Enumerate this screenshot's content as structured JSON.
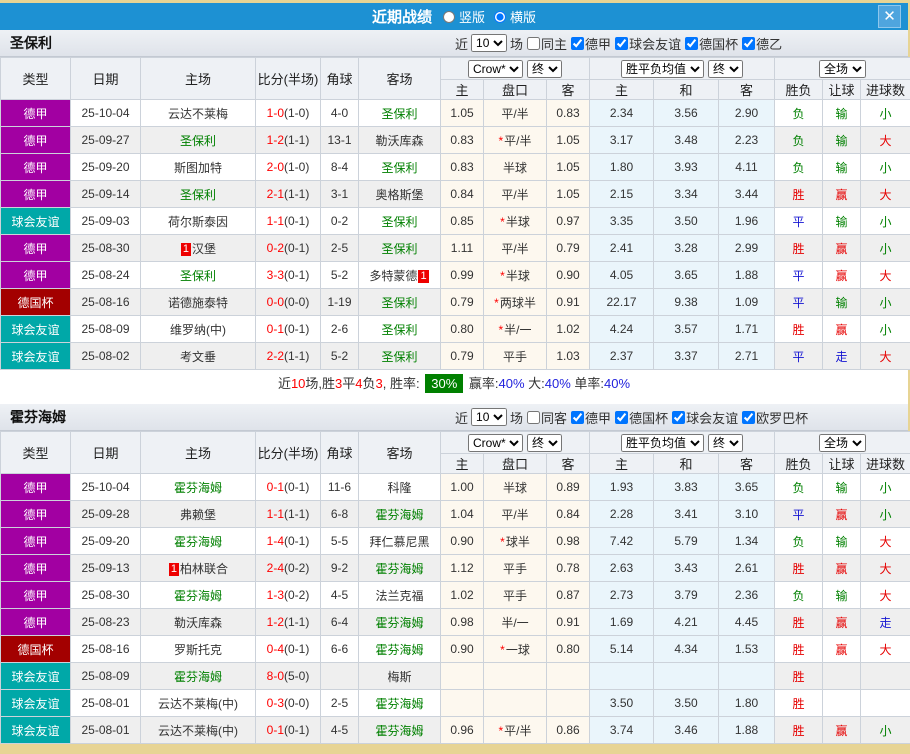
{
  "titlebar": {
    "title": "近期战绩",
    "layout_options": [
      {
        "label": "竖版",
        "selected": false
      },
      {
        "label": "横版",
        "selected": true
      }
    ],
    "close_label": "✕"
  },
  "filter_labels": {
    "near": "近",
    "games": "场"
  },
  "table_header": {
    "left_cols": [
      "类型",
      "日期",
      "主场",
      "比分(半场)",
      "角球",
      "客场"
    ],
    "odds_groups": [
      {
        "selects": [
          "Crow*",
          "终"
        ]
      },
      {
        "selects": [
          "胜平负均值",
          "终"
        ]
      },
      {
        "selects": [
          "全场"
        ]
      }
    ],
    "sub_cols": [
      "主",
      "盘口",
      "客",
      "主",
      "和",
      "客",
      "胜负",
      "让球",
      "进球数"
    ]
  },
  "colors": {
    "header_blue": "#1d91d3",
    "type": {
      "德甲": "#a200a2",
      "球会友谊": "#00a8a8",
      "德国杯": "#a30000"
    },
    "team_green": "#008000",
    "score_red": "#ff0000",
    "result": {
      "胜": "#e60000",
      "平": "#1414d2",
      "负": "#008000"
    },
    "handicap_result": {
      "赢": "#e60000",
      "输": "#008000",
      "走": "#1414d2"
    },
    "goals": {
      "大": "#e60000",
      "小": "#008000",
      "走": "#1414d2"
    }
  },
  "sections": [
    {
      "team": "圣保利",
      "filter": {
        "count": "10",
        "same_venue": {
          "label": "同主",
          "checked": false
        },
        "leagues": [
          {
            "label": "德甲",
            "checked": true
          },
          {
            "label": "球会友谊",
            "checked": true
          },
          {
            "label": "德国杯",
            "checked": true
          },
          {
            "label": "德乙",
            "checked": true
          }
        ]
      },
      "rows": [
        {
          "type": "德甲",
          "date": "25-10-04",
          "home": "云达不莱梅",
          "home_is_team": false,
          "home_badge": "",
          "home_badge_pos": "",
          "score": "1-0",
          "half": "(1-0)",
          "corner": "4-0",
          "away": "圣保利",
          "away_is_team": true,
          "away_badge": "",
          "away_badge_pos": "",
          "crow_home": "1.05",
          "handicap": "平/半",
          "handicap_star": false,
          "crow_away": "0.83",
          "avg_home": "2.34",
          "avg_draw": "3.56",
          "avg_away": "2.90",
          "result": "负",
          "handicap_result": "输",
          "goals_result": "小"
        },
        {
          "type": "德甲",
          "date": "25-09-27",
          "home": "圣保利",
          "home_is_team": true,
          "home_badge": "",
          "home_badge_pos": "",
          "score": "1-2",
          "half": "(1-1)",
          "corner": "13-1",
          "away": "勒沃库森",
          "away_is_team": false,
          "away_badge": "",
          "away_badge_pos": "",
          "crow_home": "0.83",
          "handicap": "平/半",
          "handicap_star": true,
          "crow_away": "1.05",
          "avg_home": "3.17",
          "avg_draw": "3.48",
          "avg_away": "2.23",
          "result": "负",
          "handicap_result": "输",
          "goals_result": "大"
        },
        {
          "type": "德甲",
          "date": "25-09-20",
          "home": "斯图加特",
          "home_is_team": false,
          "home_badge": "",
          "home_badge_pos": "",
          "score": "2-0",
          "half": "(1-0)",
          "corner": "8-4",
          "away": "圣保利",
          "away_is_team": true,
          "away_badge": "",
          "away_badge_pos": "",
          "crow_home": "0.83",
          "handicap": "半球",
          "handicap_star": false,
          "crow_away": "1.05",
          "avg_home": "1.80",
          "avg_draw": "3.93",
          "avg_away": "4.11",
          "result": "负",
          "handicap_result": "输",
          "goals_result": "小"
        },
        {
          "type": "德甲",
          "date": "25-09-14",
          "home": "圣保利",
          "home_is_team": true,
          "home_badge": "",
          "home_badge_pos": "",
          "score": "2-1",
          "half": "(1-1)",
          "corner": "3-1",
          "away": "奥格斯堡",
          "away_is_team": false,
          "away_badge": "",
          "away_badge_pos": "",
          "crow_home": "0.84",
          "handicap": "平/半",
          "handicap_star": false,
          "crow_away": "1.05",
          "avg_home": "2.15",
          "avg_draw": "3.34",
          "avg_away": "3.44",
          "result": "胜",
          "handicap_result": "赢",
          "goals_result": "大"
        },
        {
          "type": "球会友谊",
          "date": "25-09-03",
          "home": "荷尔斯泰因",
          "home_is_team": false,
          "home_badge": "",
          "home_badge_pos": "",
          "score": "1-1",
          "half": "(0-1)",
          "corner": "0-2",
          "away": "圣保利",
          "away_is_team": true,
          "away_badge": "",
          "away_badge_pos": "",
          "crow_home": "0.85",
          "handicap": "半球",
          "handicap_star": true,
          "crow_away": "0.97",
          "avg_home": "3.35",
          "avg_draw": "3.50",
          "avg_away": "1.96",
          "result": "平",
          "handicap_result": "输",
          "goals_result": "小"
        },
        {
          "type": "德甲",
          "date": "25-08-30",
          "home": "汉堡",
          "home_is_team": false,
          "home_badge": "1",
          "home_badge_pos": "before",
          "score": "0-2",
          "half": "(0-1)",
          "corner": "2-5",
          "away": "圣保利",
          "away_is_team": true,
          "away_badge": "",
          "away_badge_pos": "",
          "crow_home": "1.11",
          "handicap": "平/半",
          "handicap_star": false,
          "crow_away": "0.79",
          "avg_home": "2.41",
          "avg_draw": "3.28",
          "avg_away": "2.99",
          "result": "胜",
          "handicap_result": "赢",
          "goals_result": "小"
        },
        {
          "type": "德甲",
          "date": "25-08-24",
          "home": "圣保利",
          "home_is_team": true,
          "home_badge": "",
          "home_badge_pos": "",
          "score": "3-3",
          "half": "(0-1)",
          "corner": "5-2",
          "away": "多特蒙德",
          "away_is_team": false,
          "away_badge": "1",
          "away_badge_pos": "after",
          "crow_home": "0.99",
          "handicap": "半球",
          "handicap_star": true,
          "crow_away": "0.90",
          "avg_home": "4.05",
          "avg_draw": "3.65",
          "avg_away": "1.88",
          "result": "平",
          "handicap_result": "赢",
          "goals_result": "大"
        },
        {
          "type": "德国杯",
          "date": "25-08-16",
          "home": "诺德施泰特",
          "home_is_team": false,
          "home_badge": "",
          "home_badge_pos": "",
          "score": "0-0",
          "half": "(0-0)",
          "corner": "1-19",
          "away": "圣保利",
          "away_is_team": true,
          "away_badge": "",
          "away_badge_pos": "",
          "crow_home": "0.79",
          "handicap": "两球半",
          "handicap_star": true,
          "crow_away": "0.91",
          "avg_home": "22.17",
          "avg_draw": "9.38",
          "avg_away": "1.09",
          "result": "平",
          "handicap_result": "输",
          "goals_result": "小"
        },
        {
          "type": "球会友谊",
          "date": "25-08-09",
          "home": "维罗纳(中)",
          "home_is_team": false,
          "home_badge": "",
          "home_badge_pos": "",
          "score": "0-1",
          "half": "(0-1)",
          "corner": "2-6",
          "away": "圣保利",
          "away_is_team": true,
          "away_badge": "",
          "away_badge_pos": "",
          "crow_home": "0.80",
          "handicap": "半/一",
          "handicap_star": true,
          "crow_away": "1.02",
          "avg_home": "4.24",
          "avg_draw": "3.57",
          "avg_away": "1.71",
          "result": "胜",
          "handicap_result": "赢",
          "goals_result": "小"
        },
        {
          "type": "球会友谊",
          "date": "25-08-02",
          "home": "考文垂",
          "home_is_team": false,
          "home_badge": "",
          "home_badge_pos": "",
          "score": "2-2",
          "half": "(1-1)",
          "corner": "5-2",
          "away": "圣保利",
          "away_is_team": true,
          "away_badge": "",
          "away_badge_pos": "",
          "crow_home": "0.79",
          "handicap": "平手",
          "handicap_star": false,
          "crow_away": "1.03",
          "avg_home": "2.37",
          "avg_draw": "3.37",
          "avg_away": "2.71",
          "result": "平",
          "handicap_result": "走",
          "goals_result": "大"
        }
      ],
      "summary_parts": [
        {
          "t": "近"
        },
        {
          "t": "10",
          "c": "red"
        },
        {
          "t": "场,胜"
        },
        {
          "t": "3",
          "c": "red"
        },
        {
          "t": "平"
        },
        {
          "t": "4",
          "c": "red"
        },
        {
          "t": "负"
        },
        {
          "t": "3",
          "c": "red"
        },
        {
          "t": ", 胜率: "
        },
        {
          "t": "30%",
          "c": "greenbox"
        },
        {
          "t": " 赢率:"
        },
        {
          "t": "40%",
          "c": "blue"
        },
        {
          "t": " 大:"
        },
        {
          "t": "40%",
          "c": "blue"
        },
        {
          "t": " 单率:"
        },
        {
          "t": "40%",
          "c": "blue"
        }
      ]
    },
    {
      "team": "霍芬海姆",
      "filter": {
        "count": "10",
        "same_venue": {
          "label": "同客",
          "checked": false
        },
        "leagues": [
          {
            "label": "德甲",
            "checked": true
          },
          {
            "label": "德国杯",
            "checked": true
          },
          {
            "label": "球会友谊",
            "checked": true
          },
          {
            "label": "欧罗巴杯",
            "checked": true
          }
        ]
      },
      "rows": [
        {
          "type": "德甲",
          "date": "25-10-04",
          "home": "霍芬海姆",
          "home_is_team": true,
          "home_badge": "",
          "home_badge_pos": "",
          "score": "0-1",
          "half": "(0-1)",
          "corner": "11-6",
          "away": "科隆",
          "away_is_team": false,
          "away_badge": "",
          "away_badge_pos": "",
          "crow_home": "1.00",
          "handicap": "半球",
          "handicap_star": false,
          "crow_away": "0.89",
          "avg_home": "1.93",
          "avg_draw": "3.83",
          "avg_away": "3.65",
          "result": "负",
          "handicap_result": "输",
          "goals_result": "小"
        },
        {
          "type": "德甲",
          "date": "25-09-28",
          "home": "弗赖堡",
          "home_is_team": false,
          "home_badge": "",
          "home_badge_pos": "",
          "score": "1-1",
          "half": "(1-1)",
          "corner": "6-8",
          "away": "霍芬海姆",
          "away_is_team": true,
          "away_badge": "",
          "away_badge_pos": "",
          "crow_home": "1.04",
          "handicap": "平/半",
          "handicap_star": false,
          "crow_away": "0.84",
          "avg_home": "2.28",
          "avg_draw": "3.41",
          "avg_away": "3.10",
          "result": "平",
          "handicap_result": "赢",
          "goals_result": "小"
        },
        {
          "type": "德甲",
          "date": "25-09-20",
          "home": "霍芬海姆",
          "home_is_team": true,
          "home_badge": "",
          "home_badge_pos": "",
          "score": "1-4",
          "half": "(0-1)",
          "corner": "5-5",
          "away": "拜仁慕尼黑",
          "away_is_team": false,
          "away_badge": "",
          "away_badge_pos": "",
          "crow_home": "0.90",
          "handicap": "球半",
          "handicap_star": true,
          "crow_away": "0.98",
          "avg_home": "7.42",
          "avg_draw": "5.79",
          "avg_away": "1.34",
          "result": "负",
          "handicap_result": "输",
          "goals_result": "大"
        },
        {
          "type": "德甲",
          "date": "25-09-13",
          "home": "柏林联合",
          "home_is_team": false,
          "home_badge": "1",
          "home_badge_pos": "before",
          "score": "2-4",
          "half": "(0-2)",
          "corner": "9-2",
          "away": "霍芬海姆",
          "away_is_team": true,
          "away_badge": "",
          "away_badge_pos": "",
          "crow_home": "1.12",
          "handicap": "平手",
          "handicap_star": false,
          "crow_away": "0.78",
          "avg_home": "2.63",
          "avg_draw": "3.43",
          "avg_away": "2.61",
          "result": "胜",
          "handicap_result": "赢",
          "goals_result": "大"
        },
        {
          "type": "德甲",
          "date": "25-08-30",
          "home": "霍芬海姆",
          "home_is_team": true,
          "home_badge": "",
          "home_badge_pos": "",
          "score": "1-3",
          "half": "(0-2)",
          "corner": "4-5",
          "away": "法兰克福",
          "away_is_team": false,
          "away_badge": "",
          "away_badge_pos": "",
          "crow_home": "1.02",
          "handicap": "平手",
          "handicap_star": false,
          "crow_away": "0.87",
          "avg_home": "2.73",
          "avg_draw": "3.79",
          "avg_away": "2.36",
          "result": "负",
          "handicap_result": "输",
          "goals_result": "大"
        },
        {
          "type": "德甲",
          "date": "25-08-23",
          "home": "勒沃库森",
          "home_is_team": false,
          "home_badge": "",
          "home_badge_pos": "",
          "score": "1-2",
          "half": "(1-1)",
          "corner": "6-4",
          "away": "霍芬海姆",
          "away_is_team": true,
          "away_badge": "",
          "away_badge_pos": "",
          "crow_home": "0.98",
          "handicap": "半/一",
          "handicap_star": false,
          "crow_away": "0.91",
          "avg_home": "1.69",
          "avg_draw": "4.21",
          "avg_away": "4.45",
          "result": "胜",
          "handicap_result": "赢",
          "goals_result": "走"
        },
        {
          "type": "德国杯",
          "date": "25-08-16",
          "home": "罗斯托克",
          "home_is_team": false,
          "home_badge": "",
          "home_badge_pos": "",
          "score": "0-4",
          "half": "(0-1)",
          "corner": "6-6",
          "away": "霍芬海姆",
          "away_is_team": true,
          "away_badge": "",
          "away_badge_pos": "",
          "crow_home": "0.90",
          "handicap": "一球",
          "handicap_star": true,
          "crow_away": "0.80",
          "avg_home": "5.14",
          "avg_draw": "4.34",
          "avg_away": "1.53",
          "result": "胜",
          "handicap_result": "赢",
          "goals_result": "大"
        },
        {
          "type": "球会友谊",
          "date": "25-08-09",
          "home": "霍芬海姆",
          "home_is_team": true,
          "home_badge": "",
          "home_badge_pos": "",
          "score": "8-0",
          "half": "(5-0)",
          "corner": "",
          "away": "梅斯",
          "away_is_team": false,
          "away_badge": "",
          "away_badge_pos": "",
          "crow_home": "",
          "handicap": "",
          "handicap_star": false,
          "crow_away": "",
          "avg_home": "",
          "avg_draw": "",
          "avg_away": "",
          "result": "胜",
          "handicap_result": "",
          "goals_result": ""
        },
        {
          "type": "球会友谊",
          "date": "25-08-01",
          "home": "云达不莱梅(中)",
          "home_is_team": false,
          "home_badge": "",
          "home_badge_pos": "",
          "score": "0-3",
          "half": "(0-0)",
          "corner": "2-5",
          "away": "霍芬海姆",
          "away_is_team": true,
          "away_badge": "",
          "away_badge_pos": "",
          "crow_home": "",
          "handicap": "",
          "handicap_star": false,
          "crow_away": "",
          "avg_home": "3.50",
          "avg_draw": "3.50",
          "avg_away": "1.80",
          "result": "胜",
          "handicap_result": "",
          "goals_result": ""
        },
        {
          "type": "球会友谊",
          "date": "25-08-01",
          "home": "云达不莱梅(中)",
          "home_is_team": false,
          "home_badge": "",
          "home_badge_pos": "",
          "score": "0-1",
          "half": "(0-1)",
          "corner": "4-5",
          "away": "霍芬海姆",
          "away_is_team": true,
          "away_badge": "",
          "away_badge_pos": "",
          "crow_home": "0.96",
          "handicap": "平/半",
          "handicap_star": true,
          "crow_away": "0.86",
          "avg_home": "3.74",
          "avg_draw": "3.46",
          "avg_away": "1.88",
          "result": "胜",
          "handicap_result": "赢",
          "goals_result": "小"
        }
      ],
      "summary_parts": null
    }
  ]
}
